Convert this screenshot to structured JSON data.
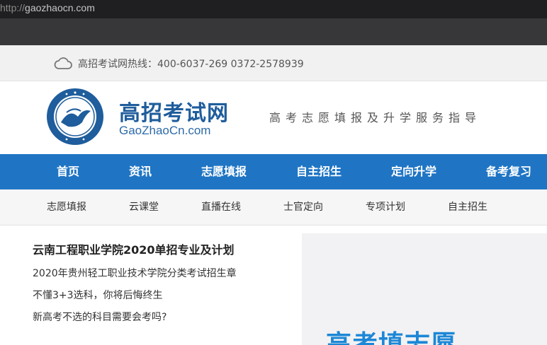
{
  "browser": {
    "url_scheme": "http://",
    "url_host": "gaozhaocn.com"
  },
  "topbar": {
    "hotline": "高招考试网热线：400-6037-269 0372-2578939"
  },
  "header": {
    "brand_cn": "高招考试网",
    "brand_en": "GaoZhaoCn.com",
    "slogan": "高考志愿填报及升学服务指导"
  },
  "main_nav": {
    "items": [
      {
        "label": "首页"
      },
      {
        "label": "资讯"
      },
      {
        "label": "志愿填报"
      },
      {
        "label": "自主招生"
      },
      {
        "label": "定向升学"
      },
      {
        "label": "备考复习"
      }
    ]
  },
  "sub_nav": {
    "items": [
      {
        "label": "志愿填报"
      },
      {
        "label": "云课堂"
      },
      {
        "label": "直播在线"
      },
      {
        "label": "士官定向"
      },
      {
        "label": "专项计划"
      },
      {
        "label": "自主招生"
      }
    ]
  },
  "content": {
    "headline": "云南工程职业学院2020单招专业及计划",
    "news": [
      {
        "title": "2020年贵州轻工职业技术学院分类考试招生章"
      },
      {
        "title": "不懂3+3选科，你将后悔终生"
      },
      {
        "title": "新高考不选的科目需要会考吗?"
      }
    ]
  },
  "banner": {
    "text": "高考填志愿"
  },
  "colors": {
    "nav_blue": "#1f75c4",
    "brand_blue": "#1f5d9c",
    "banner_blue": "#1d87d6"
  }
}
